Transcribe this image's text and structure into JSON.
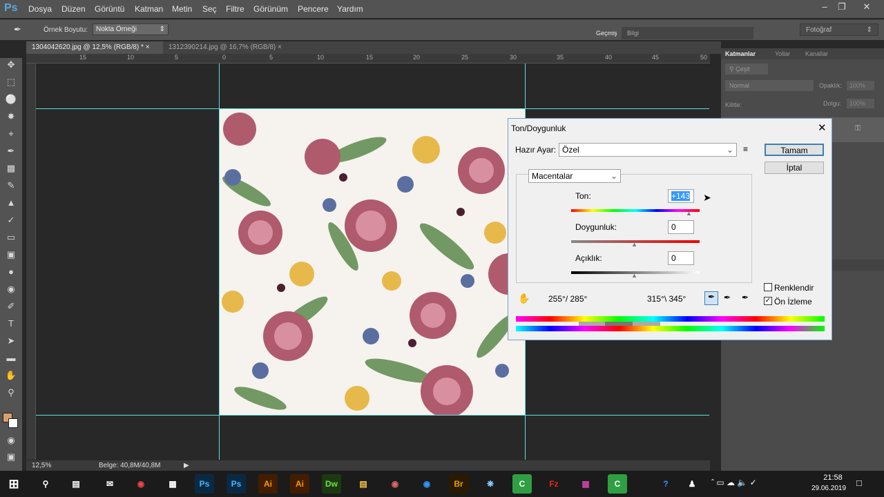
{
  "app": {
    "logo": "Ps"
  },
  "menu": [
    "Dosya",
    "Düzen",
    "Görüntü",
    "Katman",
    "Metin",
    "Seç",
    "Filtre",
    "Görünüm",
    "Pencere",
    "Yardım"
  ],
  "options": {
    "sample_label": "Örnek Boyutu:",
    "sample_value": "Nokta Örneği",
    "history_tab": "Geçmiş",
    "info_tab": "Bilgi",
    "workspace": "Fotoğraf"
  },
  "tabs": [
    "1304042620.jpg @ 12,5% (RGB/8) *",
    "1312390214.jpg @ 16,7% (RGB/8)"
  ],
  "ruler_h": [
    "15",
    "10",
    "5",
    "0",
    "5",
    "10",
    "15",
    "20",
    "25",
    "30",
    "35",
    "40",
    "45",
    "50"
  ],
  "status": {
    "zoom": "12,5%",
    "doc": "Belge: 40,8M/40,8M"
  },
  "layers": {
    "tabs": [
      "Katmanlar",
      "Yollar",
      "Kanallar"
    ],
    "kind": "Çeşit",
    "blend": "Normal",
    "opacity_label": "Opaklık:",
    "opacity_val": "100%",
    "lock_label": "Kilitle:",
    "fill_label": "Dolgu:",
    "fill_val": "100%"
  },
  "dialog": {
    "title": "Ton/Doygunluk",
    "preset_label": "Hazır Ayar:",
    "preset_value": "Özel",
    "ok": "Tamam",
    "cancel": "İptal",
    "channel": "Macentalar",
    "hue_label": "Ton:",
    "hue_value": "+143",
    "sat_label": "Doygunluk:",
    "sat_value": "0",
    "light_label": "Açıklık:",
    "light_value": "0",
    "range_left": "255°/ 285°",
    "range_right": "315°\\ 345°",
    "colorize": "Renklendir",
    "preview": "Ön İzleme",
    "colorize_checked": false,
    "preview_checked": true
  },
  "clock": {
    "time": "21:58",
    "date": "29.06.2019"
  }
}
